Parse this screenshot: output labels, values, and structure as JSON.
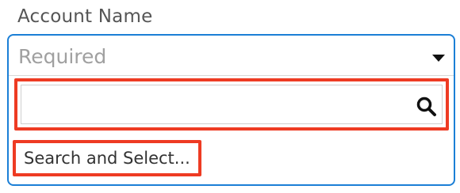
{
  "field": {
    "label": "Account Name",
    "selected_placeholder": "Required"
  },
  "dropdown": {
    "search_value": "",
    "search_icon": "search-icon",
    "items": [
      {
        "label": "Search and Select..."
      }
    ]
  },
  "colors": {
    "focus_border": "#1b7fd6",
    "highlight_border": "#ee3b23",
    "label_text": "#555555",
    "placeholder_text": "#a0a0a0"
  }
}
